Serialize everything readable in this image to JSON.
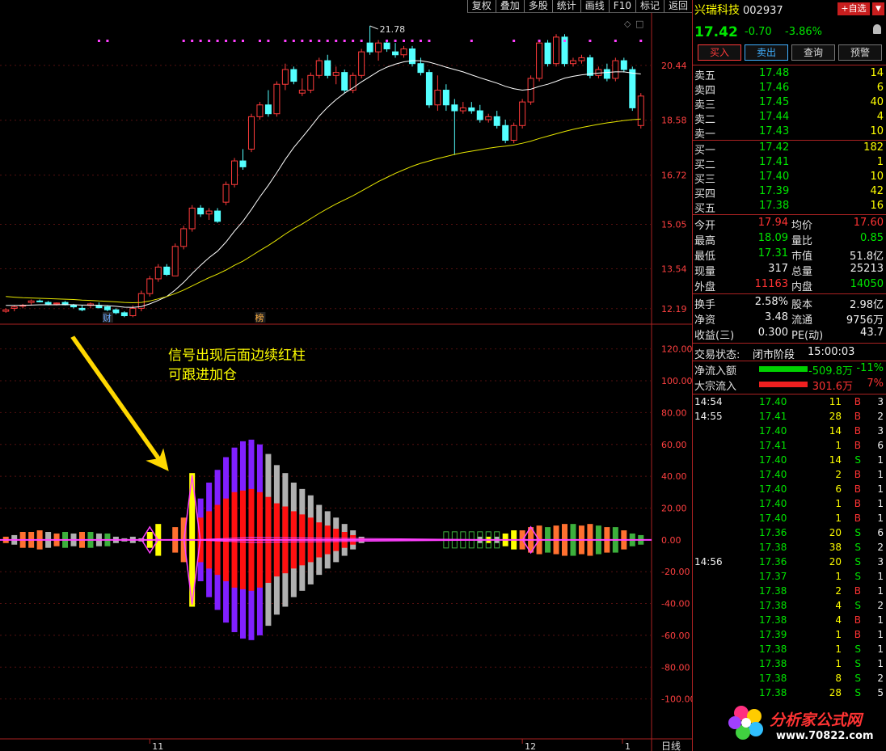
{
  "toolbar": [
    "复权",
    "叠加",
    "多股",
    "统计",
    "画线",
    "F10",
    "标记",
    "返回"
  ],
  "annotation": {
    "line1": "信号出现后面边续红柱",
    "line2": "可跟进加仓"
  },
  "main_chart": {
    "y_ticks": [
      "20.44",
      "18.58",
      "16.72",
      "15.05",
      "13.54",
      "12.19"
    ],
    "high_label": "21.78",
    "markers": [
      "财",
      "榜"
    ]
  },
  "indicator_chart": {
    "y_ticks": [
      "120.00",
      "100.00",
      "80.00",
      "60.00",
      "40.00",
      "20.00",
      "0.00",
      "-20.00",
      "-40.00",
      "-60.00",
      "-80.00",
      "-100.00"
    ]
  },
  "x_axis": {
    "labels": [
      "11",
      "12",
      "1"
    ],
    "period": "日线"
  },
  "chart_data": [
    {
      "type": "candlestick",
      "title": "",
      "ylim": [
        12.0,
        22.0
      ],
      "candles": [
        [
          12.1,
          12.2,
          12.05,
          12.15
        ],
        [
          12.2,
          12.3,
          12.1,
          12.25
        ],
        [
          12.3,
          12.35,
          12.2,
          12.3
        ],
        [
          12.4,
          12.5,
          12.3,
          12.45
        ],
        [
          12.45,
          12.5,
          12.4,
          12.42
        ],
        [
          12.4,
          12.45,
          12.3,
          12.35
        ],
        [
          12.35,
          12.4,
          12.3,
          12.38
        ],
        [
          12.4,
          12.45,
          12.3,
          12.32
        ],
        [
          12.3,
          12.35,
          12.2,
          12.25
        ],
        [
          12.2,
          12.3,
          12.1,
          12.15
        ],
        [
          12.3,
          12.4,
          12.2,
          12.35
        ],
        [
          12.3,
          12.4,
          12.2,
          12.22
        ],
        [
          12.25,
          12.3,
          12.1,
          12.15
        ],
        [
          12.15,
          12.2,
          12.0,
          12.05
        ],
        [
          12.05,
          12.1,
          11.9,
          11.95
        ],
        [
          11.95,
          12.3,
          11.9,
          12.2
        ],
        [
          12.2,
          12.8,
          12.1,
          12.7
        ],
        [
          12.7,
          13.3,
          12.6,
          13.2
        ],
        [
          13.2,
          13.7,
          13.1,
          13.6
        ],
        [
          13.6,
          13.7,
          13.3,
          13.35
        ],
        [
          13.3,
          14.4,
          13.3,
          14.3
        ],
        [
          14.3,
          15.0,
          14.2,
          14.9
        ],
        [
          14.9,
          15.7,
          14.8,
          15.6
        ],
        [
          15.6,
          15.7,
          15.3,
          15.4
        ],
        [
          15.4,
          15.6,
          15.2,
          15.5
        ],
        [
          15.5,
          15.6,
          15.1,
          15.15
        ],
        [
          15.8,
          16.5,
          15.7,
          16.4
        ],
        [
          16.4,
          17.3,
          16.3,
          17.2
        ],
        [
          17.2,
          17.6,
          16.9,
          17.0
        ],
        [
          17.6,
          18.8,
          17.5,
          18.7
        ],
        [
          18.7,
          19.2,
          18.6,
          19.1
        ],
        [
          19.1,
          19.6,
          18.7,
          18.8
        ],
        [
          18.8,
          19.9,
          18.7,
          19.8
        ],
        [
          19.8,
          20.5,
          19.6,
          20.3
        ],
        [
          20.3,
          20.4,
          19.8,
          19.9
        ],
        [
          19.5,
          20.0,
          19.4,
          19.6
        ],
        [
          19.6,
          20.2,
          19.5,
          20.1
        ],
        [
          20.1,
          20.7,
          20.0,
          20.6
        ],
        [
          20.6,
          20.8,
          20.0,
          20.1
        ],
        [
          20.1,
          20.4,
          19.8,
          20.2
        ],
        [
          20.2,
          20.3,
          19.5,
          19.6
        ],
        [
          19.6,
          20.2,
          19.5,
          20.1
        ],
        [
          20.1,
          21.0,
          20.0,
          20.9
        ],
        [
          21.2,
          21.78,
          20.8,
          20.9
        ],
        [
          20.9,
          21.3,
          20.6,
          21.2
        ],
        [
          21.2,
          21.3,
          20.9,
          21.0
        ],
        [
          20.9,
          21.2,
          20.7,
          20.8
        ],
        [
          20.8,
          21.1,
          20.7,
          21.0
        ],
        [
          21.0,
          21.1,
          20.4,
          20.5
        ],
        [
          20.5,
          20.7,
          20.1,
          20.2
        ],
        [
          20.2,
          20.3,
          19.0,
          19.1
        ],
        [
          19.1,
          20.1,
          18.9,
          19.6
        ],
        [
          19.6,
          19.8,
          18.9,
          19.1
        ],
        [
          19.1,
          19.3,
          17.4,
          18.9
        ],
        [
          18.9,
          19.2,
          18.8,
          19.0
        ],
        [
          19.0,
          19.2,
          18.8,
          18.9
        ],
        [
          18.9,
          19.1,
          18.5,
          18.6
        ],
        [
          18.6,
          18.8,
          18.5,
          18.7
        ],
        [
          18.7,
          18.9,
          18.3,
          18.4
        ],
        [
          18.4,
          18.6,
          17.8,
          17.9
        ],
        [
          17.9,
          18.5,
          17.8,
          18.4
        ],
        [
          18.4,
          19.3,
          18.3,
          19.2
        ],
        [
          19.2,
          20.1,
          19.1,
          20.0
        ],
        [
          20.0,
          21.3,
          19.9,
          21.2
        ],
        [
          21.2,
          21.3,
          20.4,
          20.5
        ],
        [
          20.5,
          21.5,
          20.4,
          21.4
        ],
        [
          21.4,
          21.5,
          20.4,
          20.5
        ],
        [
          20.5,
          20.7,
          20.4,
          20.6
        ],
        [
          20.6,
          20.8,
          20.5,
          20.7
        ],
        [
          20.7,
          20.8,
          20.0,
          20.1
        ],
        [
          20.1,
          20.4,
          20.0,
          20.3
        ],
        [
          20.3,
          20.5,
          19.9,
          20.0
        ],
        [
          20.0,
          20.7,
          19.9,
          20.6
        ],
        [
          20.6,
          20.7,
          20.2,
          20.3
        ],
        [
          20.3,
          20.4,
          18.9,
          19.0
        ],
        [
          18.4,
          19.5,
          18.3,
          19.4
        ]
      ],
      "ma_white": [
        12.3,
        12.3,
        12.3,
        12.31,
        12.32,
        12.32,
        12.32,
        12.33,
        12.32,
        12.31,
        12.31,
        12.3,
        12.29,
        12.27,
        12.24,
        12.23,
        12.26,
        12.35,
        12.47,
        12.6,
        12.82,
        13.08,
        13.38,
        13.66,
        13.92,
        14.14,
        14.45,
        14.82,
        15.15,
        15.55,
        15.98,
        16.37,
        16.8,
        17.25,
        17.65,
        18.0,
        18.35,
        18.72,
        19.02,
        19.28,
        19.5,
        19.68,
        19.88,
        20.06,
        20.24,
        20.38,
        20.48,
        20.56,
        20.6,
        20.6,
        20.55,
        20.47,
        20.38,
        20.3,
        20.22,
        20.12,
        20.02,
        19.93,
        19.84,
        19.73,
        19.65,
        19.6,
        19.63,
        19.73,
        19.8,
        19.9,
        20.01,
        20.07,
        20.12,
        20.15,
        20.18,
        20.2,
        20.22,
        20.22,
        20.18,
        20.15
      ],
      "ma_yellow": [
        12.6,
        12.58,
        12.56,
        12.55,
        12.54,
        12.53,
        12.52,
        12.51,
        12.5,
        12.48,
        12.47,
        12.45,
        12.44,
        12.42,
        12.4,
        12.39,
        12.4,
        12.45,
        12.52,
        12.6,
        12.7,
        12.82,
        12.96,
        13.1,
        13.24,
        13.36,
        13.5,
        13.66,
        13.8,
        13.98,
        14.16,
        14.33,
        14.52,
        14.72,
        14.9,
        15.06,
        15.24,
        15.42,
        15.58,
        15.74,
        15.88,
        16.02,
        16.18,
        16.34,
        16.5,
        16.64,
        16.78,
        16.9,
        17.02,
        17.12,
        17.2,
        17.28,
        17.35,
        17.42,
        17.48,
        17.53,
        17.58,
        17.63,
        17.67,
        17.7,
        17.74,
        17.8,
        17.87,
        17.96,
        18.04,
        18.12,
        18.2,
        18.27,
        18.33,
        18.39,
        18.44,
        18.49,
        18.53,
        18.57,
        18.6,
        18.62
      ]
    },
    {
      "type": "bar",
      "title": "",
      "ylim": [
        -120,
        130
      ],
      "bars": [
        [
          2,
          "#ff7030"
        ],
        [
          3,
          "#b0b0b0"
        ],
        [
          5,
          "#ff7030"
        ],
        [
          5,
          "#ff7030"
        ],
        [
          6,
          "#ff7030"
        ],
        [
          5,
          "#b0b0b0"
        ],
        [
          4,
          "#ff7030"
        ],
        [
          5,
          "#3cb03c"
        ],
        [
          4,
          "#b0b0b0"
        ],
        [
          5,
          "#ff7030"
        ],
        [
          5,
          "#3cb03c"
        ],
        [
          4,
          "#b0b0b0"
        ],
        [
          4,
          "#3cb03c"
        ],
        [
          2,
          "#b0b0b0"
        ],
        [
          1,
          "#b0b0b0"
        ],
        [
          2,
          "#b0b0b0"
        ],
        [
          1,
          "#b0b0b0"
        ],
        [
          -5,
          "#ffff00"
        ],
        [
          -10,
          "#ffff00"
        ],
        [
          0,
          "#b0b0b0"
        ],
        [
          -8,
          "#ff7030"
        ],
        [
          -14,
          "#ff7030"
        ],
        [
          -42,
          "#ffff00"
        ],
        [
          -26,
          "#8020ff"
        ],
        [
          -36,
          "#8020ff"
        ],
        [
          -44,
          "#8020ff"
        ],
        [
          -52,
          "#8020ff"
        ],
        [
          -58,
          "#8020ff"
        ],
        [
          -62,
          "#8020ff"
        ],
        [
          -63,
          "#8020ff"
        ],
        [
          -60,
          "#8020ff"
        ],
        [
          -54,
          "#b0b0b0"
        ],
        [
          -47,
          "#b0b0b0"
        ],
        [
          -42,
          "#b0b0b0"
        ],
        [
          -36,
          "#b0b0b0"
        ],
        [
          -32,
          "#b0b0b0"
        ],
        [
          -28,
          "#b0b0b0"
        ],
        [
          -22,
          "#b0b0b0"
        ],
        [
          -18,
          "#b0b0b0"
        ],
        [
          -14,
          "#b0b0b0"
        ],
        [
          -10,
          "#b0b0b0"
        ],
        [
          -6,
          "#b0b0b0"
        ],
        [
          -2,
          "#b0b0b0"
        ],
        [
          0,
          "#b0b0b0"
        ],
        [
          0,
          "#b0b0b0"
        ],
        [
          0,
          "#b0b0b0"
        ],
        [
          0,
          "#b0b0b0"
        ],
        [
          0,
          "#b0b0b0"
        ],
        [
          0,
          "#b0b0b0"
        ],
        [
          0,
          "#b0b0b0"
        ],
        [
          0,
          "#b0b0b0"
        ],
        [
          0,
          "#b0b0b0"
        ],
        [
          0,
          "#b0b0b0"
        ],
        [
          0,
          "#b0b0b0"
        ],
        [
          0,
          "#b0b0b0"
        ],
        [
          0,
          "#b0b0b0"
        ],
        [
          2,
          "#b0b0b0"
        ],
        [
          2,
          "#ffff00"
        ],
        [
          2,
          "#b0b0b0"
        ],
        [
          4,
          "#ffff00"
        ],
        [
          6,
          "#ffff00"
        ],
        [
          6,
          "#ff7030"
        ],
        [
          8,
          "#ff7030"
        ],
        [
          9,
          "#ff7030"
        ],
        [
          8,
          "#3cb03c"
        ],
        [
          9,
          "#ff7030"
        ],
        [
          10,
          "#ff7030"
        ],
        [
          10,
          "#3cb03c"
        ],
        [
          9,
          "#ff7030"
        ],
        [
          10,
          "#ff7030"
        ],
        [
          9,
          "#3cb03c"
        ],
        [
          8,
          "#ff7030"
        ],
        [
          8,
          "#3cb03c"
        ],
        [
          6,
          "#ff7030"
        ],
        [
          4,
          "#3cb03c"
        ],
        [
          3,
          "#3cb03c"
        ]
      ],
      "inner": [
        0,
        0,
        0,
        0,
        0,
        0,
        0,
        0,
        0,
        0,
        0,
        0,
        0,
        0,
        0,
        0,
        0,
        0,
        0,
        0,
        0,
        0,
        0,
        14,
        18,
        22,
        26,
        30,
        31,
        32,
        30,
        27,
        23,
        21,
        18,
        16,
        14,
        11,
        9,
        7,
        5,
        3,
        1,
        0,
        0,
        0,
        0,
        0,
        0,
        0,
        0,
        0,
        0,
        0,
        0,
        0,
        0,
        0,
        0,
        0,
        0,
        0,
        0,
        0,
        0,
        0,
        0,
        0,
        0,
        0,
        0,
        0,
        0,
        0,
        0,
        0
      ]
    }
  ],
  "quote": {
    "name": "兴瑞科技",
    "code": "002937",
    "add_label": "+自选",
    "dropdown": "▼",
    "price": "17.42",
    "change": "-0.70",
    "change_pct": "-3.86%",
    "trade_buttons": [
      "买入",
      "卖出",
      "查询",
      "预警"
    ],
    "asks": [
      {
        "label": "卖五",
        "price": "17.48",
        "vol": "14"
      },
      {
        "label": "卖四",
        "price": "17.46",
        "vol": "6"
      },
      {
        "label": "卖三",
        "price": "17.45",
        "vol": "40"
      },
      {
        "label": "卖二",
        "price": "17.44",
        "vol": "4"
      },
      {
        "label": "卖一",
        "price": "17.43",
        "vol": "10"
      }
    ],
    "bids": [
      {
        "label": "买一",
        "price": "17.42",
        "vol": "182"
      },
      {
        "label": "买二",
        "price": "17.41",
        "vol": "1"
      },
      {
        "label": "买三",
        "price": "17.40",
        "vol": "10"
      },
      {
        "label": "买四",
        "price": "17.39",
        "vol": "42"
      },
      {
        "label": "买五",
        "price": "17.38",
        "vol": "16"
      }
    ],
    "stats": [
      {
        "l1": "今开",
        "v1": "17.94",
        "c1": "r",
        "l2": "均价",
        "v2": "17.60",
        "c2": "r"
      },
      {
        "l1": "最高",
        "v1": "18.09",
        "c1": "g",
        "l2": "量比",
        "v2": "0.85",
        "c2": "g"
      },
      {
        "l1": "最低",
        "v1": "17.31",
        "c1": "g",
        "l2": "市值",
        "v2": "51.8亿",
        "c2": "w"
      },
      {
        "l1": "现量",
        "v1": "317",
        "c1": "w",
        "l2": "总量",
        "v2": "25213",
        "c2": "w"
      },
      {
        "l1": "外盘",
        "v1": "11163",
        "c1": "r",
        "l2": "内盘",
        "v2": "14050",
        "c2": "g"
      }
    ],
    "fin": [
      {
        "l1": "换手",
        "v1": "2.58%",
        "l2": "股本",
        "v2": "2.98亿"
      },
      {
        "l1": "净资",
        "v1": "3.48",
        "l2": "流通",
        "v2": "9756万"
      },
      {
        "l1": "收益(三)",
        "v1": "0.300",
        "l2": "PE(动)",
        "v2": "43.7"
      }
    ],
    "status_label": "交易状态:",
    "status_value": "闭市阶段",
    "status_time": "15:00:03",
    "netflow_label": "净流入额",
    "netflow_value": "-509.8万",
    "netflow_pct": "-11%",
    "block_label": "大宗流入",
    "block_value": "301.6万",
    "block_pct": "7%",
    "ticks": [
      {
        "t": "14:54",
        "p": "17.40",
        "v": "11",
        "s": "B",
        "n": "3"
      },
      {
        "t": "14:55",
        "p": "17.41",
        "v": "28",
        "s": "B",
        "n": "2"
      },
      {
        "t": "",
        "p": "17.40",
        "v": "14",
        "s": "B",
        "n": "3"
      },
      {
        "t": "",
        "p": "17.41",
        "v": "1",
        "s": "B",
        "n": "6"
      },
      {
        "t": "",
        "p": "17.40",
        "v": "14",
        "s": "S",
        "n": "1"
      },
      {
        "t": "",
        "p": "17.40",
        "v": "2",
        "s": "B",
        "n": "1"
      },
      {
        "t": "",
        "p": "17.40",
        "v": "6",
        "s": "B",
        "n": "1"
      },
      {
        "t": "",
        "p": "17.40",
        "v": "1",
        "s": "B",
        "n": "1"
      },
      {
        "t": "",
        "p": "17.40",
        "v": "1",
        "s": "B",
        "n": "1"
      },
      {
        "t": "",
        "p": "17.36",
        "v": "20",
        "s": "S",
        "n": "6"
      },
      {
        "t": "",
        "p": "17.38",
        "v": "38",
        "s": "S",
        "n": "2"
      },
      {
        "t": "14:56",
        "p": "17.36",
        "v": "20",
        "s": "S",
        "n": "3"
      },
      {
        "t": "",
        "p": "17.37",
        "v": "1",
        "s": "S",
        "n": "1"
      },
      {
        "t": "",
        "p": "17.38",
        "v": "2",
        "s": "B",
        "n": "1"
      },
      {
        "t": "",
        "p": "17.38",
        "v": "4",
        "s": "S",
        "n": "2"
      },
      {
        "t": "",
        "p": "17.38",
        "v": "4",
        "s": "B",
        "n": "1"
      },
      {
        "t": "",
        "p": "17.39",
        "v": "1",
        "s": "B",
        "n": "1"
      },
      {
        "t": "",
        "p": "17.38",
        "v": "1",
        "s": "S",
        "n": "1"
      },
      {
        "t": "",
        "p": "17.38",
        "v": "1",
        "s": "S",
        "n": "1"
      },
      {
        "t": "",
        "p": "17.38",
        "v": "8",
        "s": "S",
        "n": "2"
      },
      {
        "t": "",
        "p": "17.38",
        "v": "28",
        "s": "S",
        "n": "5"
      }
    ],
    "logo_text": "分析家公式网",
    "logo_url": "www.70822.com"
  }
}
